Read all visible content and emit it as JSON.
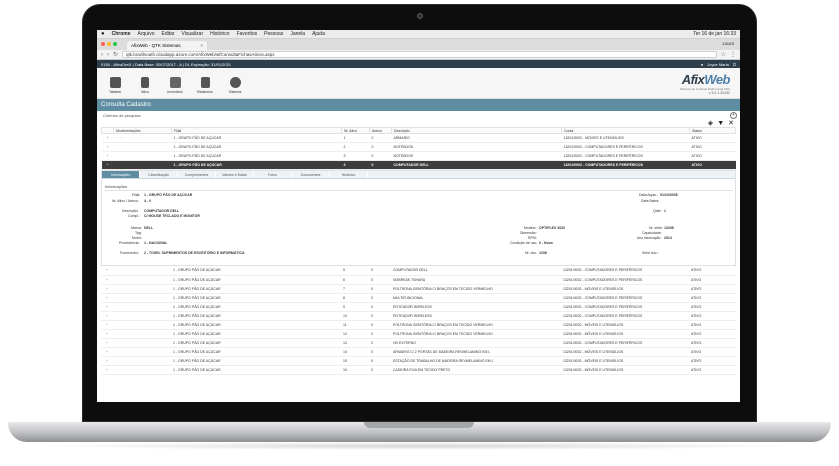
{
  "menubar": {
    "apple": "",
    "app": "Chrome",
    "items": [
      "Arquivo",
      "Editar",
      "Visualizar",
      "Histórico",
      "Favoritos",
      "Pessoas",
      "Janela",
      "Ajuda"
    ],
    "clock": "Ter 16 de jan  16:33"
  },
  "browser": {
    "tab_title": "AfixWeb - QTK Sistemas",
    "user": "Laura",
    "url": "qtk.brazilsouth.cloudapp.azure.com/AfixWeb/wfConsultaFichasAtivos.aspx"
  },
  "appbar": {
    "info": "0150 - AfixoDrel1 | Data Base: 30/07/2017 - A | DL Expiração: 31/01/2021",
    "user": "Joyce Maria"
  },
  "toolbar": {
    "items": [
      "Tabelas",
      "Ativo",
      "Inventário",
      "Relatórios",
      "Sistema"
    ]
  },
  "logo": {
    "name_a": "Afix",
    "name_b": "Web",
    "subtitle": "Sistema de Controle Patrimonial Web",
    "version": "v 3.2.1.20192"
  },
  "page": {
    "title": "Consulta Cadastro",
    "filters": "Critérios de pesquisa"
  },
  "grid_top": {
    "headers": [
      "",
      "Movimentações",
      "Filial",
      "Nr. Ativo",
      "Anexo",
      "Descrição",
      "Conta",
      "Status"
    ],
    "rows": [
      {
        "filial": "1 - GRUPO PÃO DE AÇÚCAR",
        "nr": "1",
        "anexo": "0",
        "desc": "ARMARIO",
        "conta": "13201/0002 - MÓVEIS E UTENSÍLIOS",
        "status": "ATIVO"
      },
      {
        "filial": "1 - GRUPO PÃO DE AÇÚCAR",
        "nr": "2",
        "anexo": "0",
        "desc": "NOTEBOOK",
        "conta": "13201/0002 - COMPUTADORES E PERIFÉRICOS",
        "status": "ATIVO"
      },
      {
        "filial": "1 - GRUPO PÃO DE AÇÚCAR",
        "nr": "3",
        "anexo": "0",
        "desc": "NOTEBOOK",
        "conta": "13201/0002 - COMPUTADORES E PERIFÉRICOS",
        "status": "ATIVO"
      },
      {
        "filial": "1 - GRUPO PÃO DE AÇÚCAR",
        "nr": "4",
        "anexo": "0",
        "desc": "COMPUTADOR DELL",
        "conta": "13201/0002 - COMPUTADORES E PERIFÉRICOS",
        "status": "ATIVO"
      }
    ]
  },
  "detail": {
    "tabs": [
      "Informações",
      "Classificação",
      "Complementos",
      "Valores e Datas",
      "Fotos",
      "Documentos",
      "Histórico"
    ],
    "section": "Informações",
    "filial_l": "Filial:",
    "filial_v": "1 - GRUPO PÃO DE AÇÚCAR",
    "nr_l": "Nr. Ativo / Anexo:",
    "nr_v": "4 - 0",
    "desc_l": "Descrição:",
    "desc_v": "COMPUTADOR DELL",
    "compl_l": "Compl.:",
    "compl_v": "C/ MOUSE TECLADO E MONITOR",
    "dataaq_l": "Data Aquis.:",
    "dataaq_v": "01/10/2008",
    "database_l": "Data Baixa:",
    "database_v": "",
    "qtde_l": "Qtde:",
    "qtde_v": "1",
    "marca_l": "Marca:",
    "marca_v": "DELL",
    "tag_l": "Tag:",
    "tag_v": "",
    "motor_l": "Motor:",
    "motor_v": "",
    "proc_l": "Procedência:",
    "proc_v": "1 - NACIONAL",
    "modelo_l": "Modelo:",
    "modelo_v": "OPTIPLEX 3020",
    "dim_l": "Dimensão:",
    "dim_v": "",
    "rpm_l": "RPM:",
    "rpm_v": "",
    "cond_l": "Condição de uso:",
    "cond_v": "0 - Novo",
    "serie_l": "Nr. série:",
    "serie_v": "13208",
    "cap_l": "Capacidade:",
    "cap_v": "",
    "anofab_l": "Ano fabricação:",
    "anofab_v": "2014",
    "forn_l": "Fornecedor:",
    "forn_v": "2 - TOSEL SUPRIMENTOS DE ESCRITÓRIO E INFORMÁTICA",
    "nrdoc_l": "Nr. doc:",
    "nrdoc_v": "1236",
    "seriedoc_l": "Série doc.:",
    "seriedoc_v": ""
  },
  "grid_bottom": {
    "rows": [
      {
        "filial": "1 - GRUPO PÃO DE AÇÚCAR",
        "nr": "5",
        "anexo": "0",
        "desc": "COMPUTADOR DELL",
        "conta": "13201/0002 - COMPUTADORES E PERIFÉRICOS",
        "status": "ATIVO"
      },
      {
        "filial": "1 - GRUPO PÃO DE AÇÚCAR",
        "nr": "6",
        "anexo": "0",
        "desc": "NOBREAK TSHARA",
        "conta": "13201/0002 - COMPUTADORES E PERIFÉRICOS",
        "status": "ATIVO"
      },
      {
        "filial": "1 - GRUPO PÃO DE AÇÚCAR",
        "nr": "7",
        "anexo": "0",
        "desc": "POLTRONA GIRATÓRIA C/ BRAÇOS EM TECIDO VERMELHO",
        "conta": "13201/0002 - MÓVEIS E UTENSÍLIOS",
        "status": "ATIVO"
      },
      {
        "filial": "1 - GRUPO PÃO DE AÇÚCAR",
        "nr": "8",
        "anexo": "0",
        "desc": "MULTIFUNCIONAL",
        "conta": "13201/0002 - COMPUTADORES E PERIFÉRICOS",
        "status": "ATIVO"
      },
      {
        "filial": "1 - GRUPO PÃO DE AÇÚCAR",
        "nr": "9",
        "anexo": "0",
        "desc": "ROTEADOR WIRELESS",
        "conta": "13201/0002 - COMPUTADORES E PERIFÉRICOS",
        "status": "ATIVO"
      },
      {
        "filial": "1 - GRUPO PÃO DE AÇÚCAR",
        "nr": "10",
        "anexo": "0",
        "desc": "ROTEADOR WIRELESS",
        "conta": "13201/0002 - COMPUTADORES E PERIFÉRICOS",
        "status": "ATIVO"
      },
      {
        "filial": "1 - GRUPO PÃO DE AÇÚCAR",
        "nr": "11",
        "anexo": "0",
        "desc": "POLTRONA GIRATÓRIA C/ BRAÇOS EM TECIDO VERMELHO",
        "conta": "13201/0002 - MÓVEIS E UTENSÍLIOS",
        "status": "ATIVO"
      },
      {
        "filial": "1 - GRUPO PÃO DE AÇÚCAR",
        "nr": "12",
        "anexo": "0",
        "desc": "POLTRONA GIRATÓRIA C/ BRAÇOS EM TECIDO VERMELHO",
        "conta": "13201/0002 - MÓVEIS E UTENSÍLIOS",
        "status": "ATIVO"
      },
      {
        "filial": "1 - GRUPO PÃO DE AÇÚCAR",
        "nr": "13",
        "anexo": "0",
        "desc": "HD EXTERNO",
        "conta": "13201/0002 - COMPUTADORES E PERIFÉRICOS",
        "status": "ATIVO"
      },
      {
        "filial": "1 - GRUPO PÃO DE AÇÚCAR",
        "nr": "14",
        "anexo": "0",
        "desc": "ARMARIO C/ 2 PORTAS DE MADEIRA REVMELAMINO EM L",
        "conta": "13201/0002 - MÓVEIS E UTENSÍLIOS",
        "status": "ATIVO"
      },
      {
        "filial": "1 - GRUPO PÃO DE AÇÚCAR",
        "nr": "15",
        "anexo": "0",
        "desc": "ESTAÇÃO DE TRABALHO DE MADEIRA REVMELAMINO EM L",
        "conta": "13201/0002 - MÓVEIS E UTENSÍLIOS",
        "status": "ATIVO"
      },
      {
        "filial": "1 - GRUPO PÃO DE AÇÚCAR",
        "nr": "16",
        "anexo": "0",
        "desc": "CADEIRA FIXA EM TECIDO PRETO",
        "conta": "13201/0002 - MÓVEIS E UTENSÍLIOS",
        "status": "ATIVO"
      }
    ]
  },
  "colors": {
    "header_dark": "#2d3e4d",
    "title_bar": "#5f8ea3",
    "selected_row": "#3d3d3d"
  }
}
